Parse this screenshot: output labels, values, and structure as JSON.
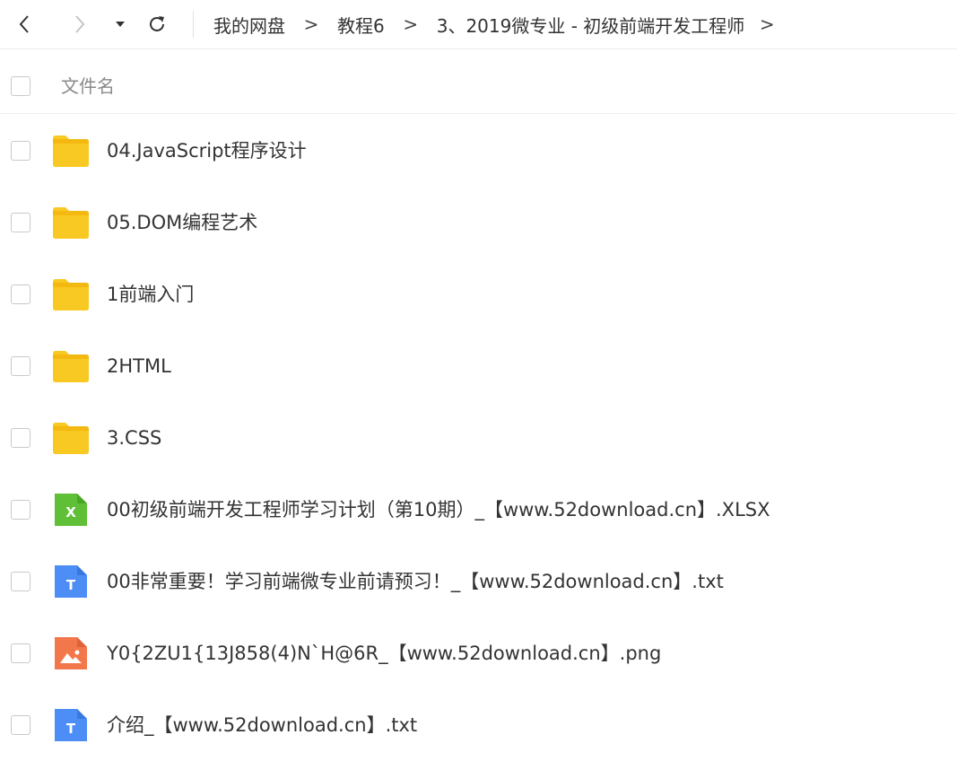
{
  "toolbar": {
    "back_icon": "chevron-left-icon",
    "forward_icon": "chevron-right-icon",
    "dropdown_icon": "caret-down-icon",
    "refresh_icon": "refresh-icon"
  },
  "breadcrumb": {
    "items": [
      "我的网盘",
      "教程6",
      "3、2019微专业 - 初级前端开发工程师"
    ],
    "separator": ">"
  },
  "list_header": {
    "label": "文件名"
  },
  "files": [
    {
      "name": "04.JavaScript程序设计",
      "icon": "folder-icon"
    },
    {
      "name": "05.DOM编程艺术",
      "icon": "folder-icon"
    },
    {
      "name": "1前端入门",
      "icon": "folder-icon"
    },
    {
      "name": "2HTML",
      "icon": "folder-icon"
    },
    {
      "name": "3.CSS",
      "icon": "folder-icon"
    },
    {
      "name": "00初级前端开发工程师学习计划（第10期）_【www.52download.cn】.XLSX",
      "icon": "excel-file-icon",
      "glyph": "X"
    },
    {
      "name": "00非常重要！学习前端微专业前请预习！_【www.52download.cn】.txt",
      "icon": "text-file-icon",
      "glyph": "T"
    },
    {
      "name": "Y0{2ZU1{13J858(4)N`H@6R_【www.52download.cn】.png",
      "icon": "image-file-icon"
    },
    {
      "name": "介绍_【www.52download.cn】.txt",
      "icon": "text-file-icon",
      "glyph": "T"
    }
  ],
  "colors": {
    "folder": "#F9C923",
    "folder_tab": "#F3B911",
    "excel": "#5FBF36",
    "text": "#4C8DF6",
    "image": "#F2784B"
  }
}
